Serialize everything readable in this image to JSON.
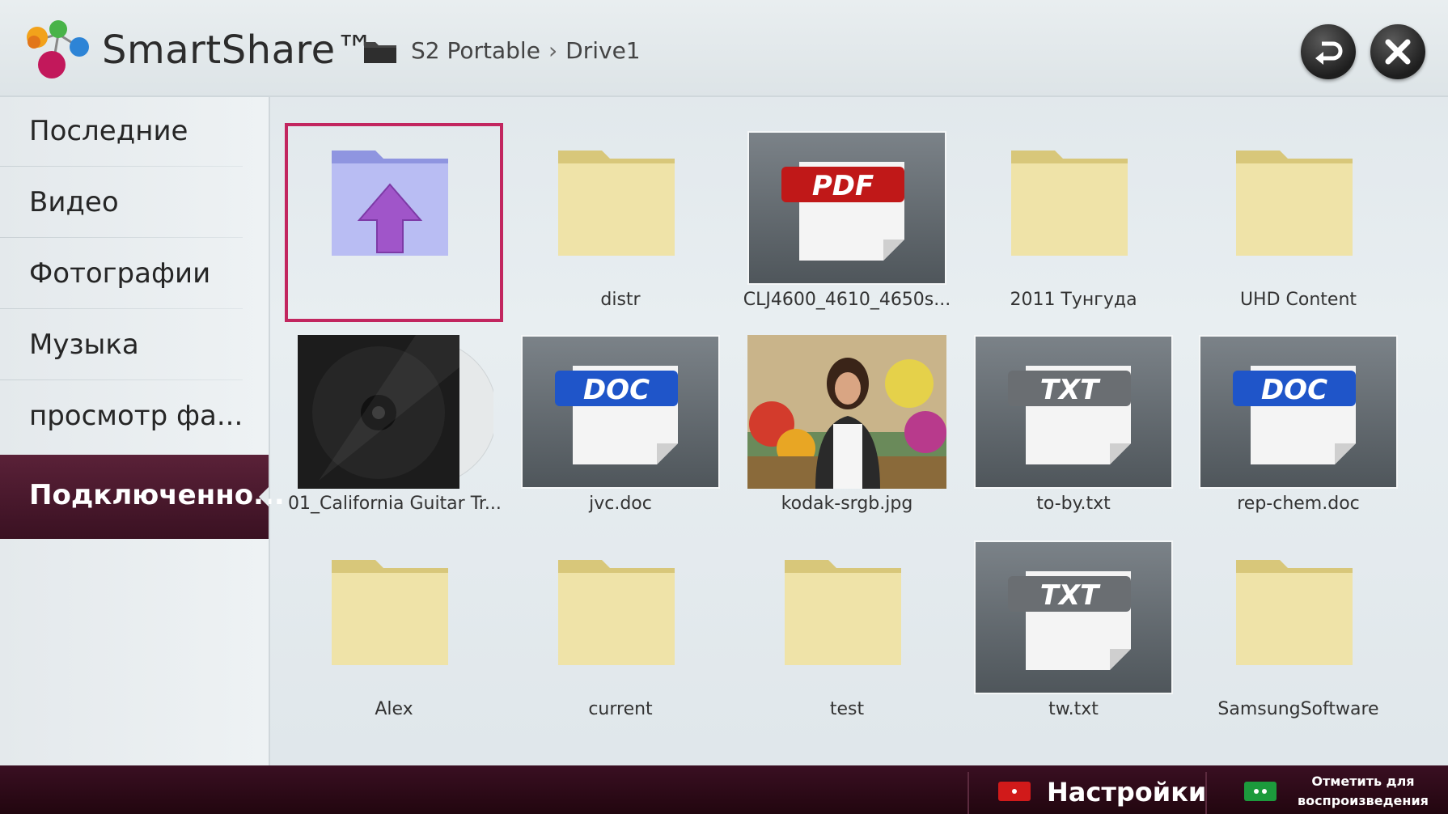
{
  "app": {
    "title": "SmartShare™"
  },
  "breadcrumb": {
    "device": "S2 Portable",
    "folder": "Drive1"
  },
  "sidebar": {
    "items": [
      {
        "label": "Последние"
      },
      {
        "label": "Видео"
      },
      {
        "label": "Фотографии"
      },
      {
        "label": "Музыка"
      },
      {
        "label": "просмотр фа..."
      }
    ],
    "active": {
      "label": "Подключенно..."
    }
  },
  "files": [
    {
      "label": "",
      "kind": "up-folder",
      "selected": true
    },
    {
      "label": "distr",
      "kind": "folder"
    },
    {
      "label": "CLJ4600_4610_4650s...",
      "kind": "pdf",
      "badge": "PDF"
    },
    {
      "label": "2011 Тунгуда",
      "kind": "folder"
    },
    {
      "label": "UHD Content",
      "kind": "folder"
    },
    {
      "label": "01_California Guitar Tr...",
      "kind": "music"
    },
    {
      "label": "jvc.doc",
      "kind": "doc",
      "badge": "DOC"
    },
    {
      "label": "kodak-srgb.jpg",
      "kind": "photo"
    },
    {
      "label": "to-by.txt",
      "kind": "txt",
      "badge": "TXT"
    },
    {
      "label": "rep-chem.doc",
      "kind": "doc",
      "badge": "DOC"
    },
    {
      "label": "Alex",
      "kind": "folder"
    },
    {
      "label": "current",
      "kind": "folder"
    },
    {
      "label": "test",
      "kind": "folder"
    },
    {
      "label": "tw.txt",
      "kind": "txt",
      "badge": "TXT"
    },
    {
      "label": "SamsungSoftware",
      "kind": "folder"
    }
  ],
  "footer": {
    "settings_label": "Настройки",
    "mark_label": "Отметить для воспроизведения"
  },
  "colors": {
    "accent": "#c2265f",
    "active_bg": "#4a1a2e",
    "key_red": "#d11a1a",
    "key_green": "#1c9a3c"
  }
}
